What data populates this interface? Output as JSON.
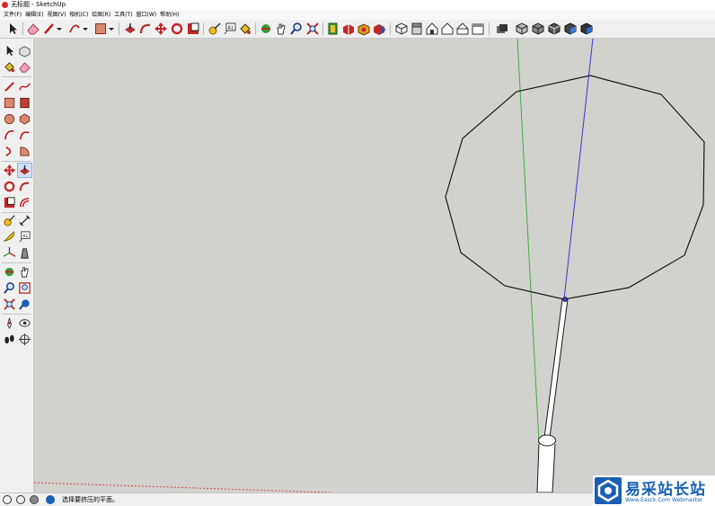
{
  "window": {
    "title": "无标题 - SketchUp"
  },
  "menu": [
    "文件(F)",
    "编辑(E)",
    "视图(V)",
    "相机(C)",
    "绘图(R)",
    "工具(T)",
    "窗口(W)",
    "帮助(H)"
  ],
  "toolbar": {
    "items": [
      "select-icon",
      "eraser-icon",
      "pencil-icon",
      "dropdown-arrow-icon",
      "arc-icon",
      "dropdown-arrow-icon",
      "rectangle-icon",
      "dropdown-arrow-icon",
      "push-pull-icon",
      "follow-me-icon",
      "move-icon",
      "rotate-icon",
      "scale-icon",
      "tape-measure-icon",
      "text-icon",
      "paint-bucket-icon",
      "orbit-icon",
      "pan-icon",
      "zoom-icon",
      "zoom-extents-icon",
      "components-icon",
      "3d-warehouse-icon",
      "extension-warehouse-icon",
      "share-model-icon",
      "iso-view-icon",
      "top-view-icon",
      "front-view-icon",
      "right-view-icon",
      "back-view-icon",
      "left-view-icon",
      "xray-style-icon",
      "wireframe-style-icon",
      "hidden-line-style-icon",
      "shaded-style-icon",
      "textured-style-icon"
    ]
  },
  "palette": {
    "items": [
      "select-icon",
      "component-icon",
      "paint-bucket-icon",
      "eraser-icon",
      "line-icon",
      "freehand-icon",
      "rectangle-icon",
      "rotated-rectangle-icon",
      "circle-icon",
      "polygon-icon",
      "arc-icon",
      "two-point-arc-icon",
      "three-point-arc-icon",
      "pie-icon",
      "move-icon",
      "push-pull-icon",
      "rotate-icon",
      "follow-me-icon",
      "scale-icon",
      "offset-icon",
      "tape-measure-icon",
      "dimension-icon",
      "protractor-icon",
      "text-icon",
      "axes-icon",
      "3d-text-icon",
      "orbit-icon",
      "pan-icon",
      "zoom-icon",
      "zoom-window-icon",
      "zoom-extents-icon",
      "previous-view-icon",
      "position-camera-icon",
      "look-around-icon",
      "walk-icon",
      "section-plane-icon"
    ],
    "active_index": 15
  },
  "status": {
    "message": "选择要挤压的平面。",
    "icons": [
      "help-icon",
      "info-icon",
      "user-icon",
      "geo-location-icon"
    ]
  },
  "watermark": {
    "text": "易采站长站",
    "sub": "Www.Easck.Com Webmaster"
  },
  "colors": {
    "viewport_bg": "#d1d1cd",
    "green_axis": "#3fae3f",
    "blue_axis": "#3a3ad6",
    "red_axis": "#d24a4a",
    "model_edge": "#1a1a1a"
  }
}
